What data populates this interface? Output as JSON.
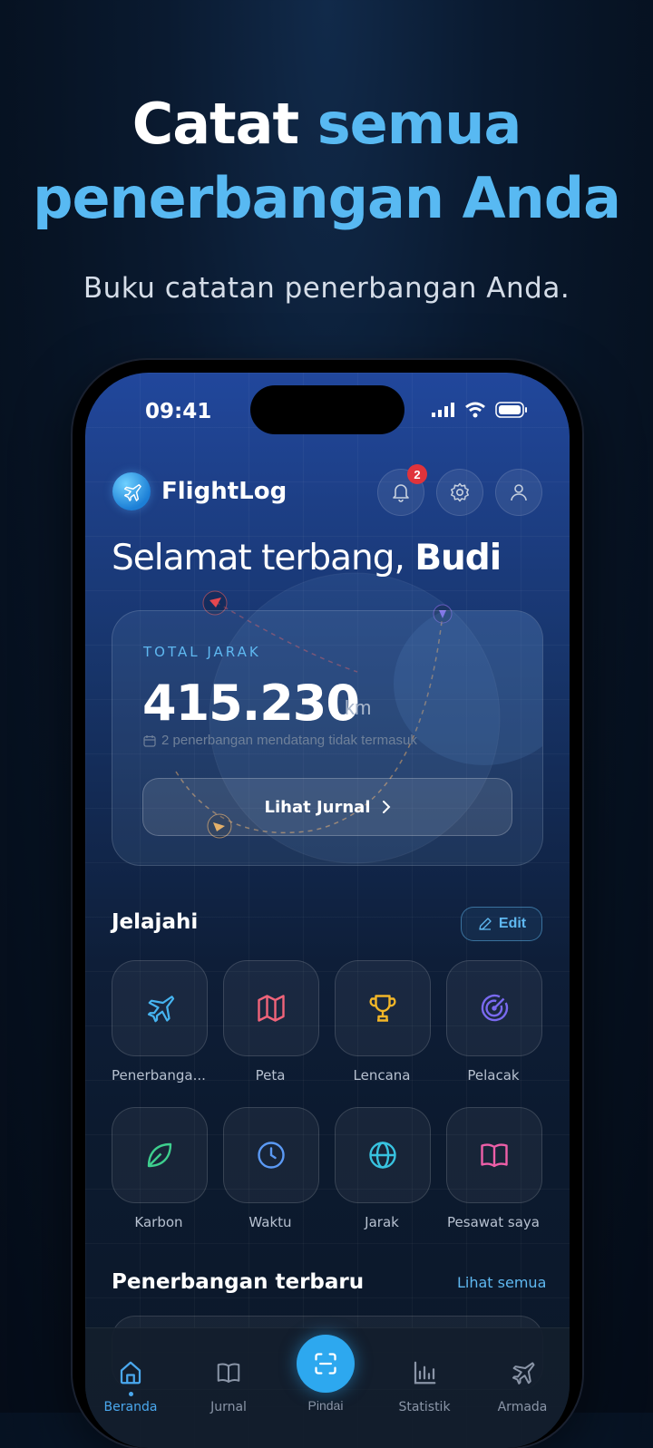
{
  "promo": {
    "headline_part1": "Catat ",
    "headline_part2": "semua",
    "headline_line2": "penerbangan Anda",
    "subtitle": "Buku catatan penerbangan Anda."
  },
  "status_bar": {
    "time": "09:41"
  },
  "header": {
    "app_name": "FlightLog",
    "notification_count": "2"
  },
  "greeting": {
    "prefix": "Selamat terbang, ",
    "name": "Budi"
  },
  "distance_card": {
    "label": "TOTAL JARAK",
    "value": "415.230",
    "unit": "km",
    "note": "2 penerbangan mendatang tidak termasuk",
    "button": "Lihat Jurnal"
  },
  "explore": {
    "title": "Jelajahi",
    "edit": "Edit",
    "tiles": [
      {
        "label": "Penerbanga...",
        "icon": "plane-icon",
        "color": "#46b4f0"
      },
      {
        "label": "Peta",
        "icon": "map-icon",
        "color": "#f0647a"
      },
      {
        "label": "Lencana",
        "icon": "trophy-icon",
        "color": "#f2b628"
      },
      {
        "label": "Pelacak",
        "icon": "radar-icon",
        "color": "#7a6af0"
      },
      {
        "label": "Karbon",
        "icon": "leaf-icon",
        "color": "#3ecf8e"
      },
      {
        "label": "Waktu",
        "icon": "clock-icon",
        "color": "#5b9af5"
      },
      {
        "label": "Jarak",
        "icon": "globe-icon",
        "color": "#38c3e0"
      },
      {
        "label": "Pesawat saya",
        "icon": "book-icon",
        "color": "#ee5fa8"
      }
    ]
  },
  "recent": {
    "title": "Penerbangan terbaru",
    "see_all": "Lihat semua"
  },
  "tabbar": {
    "tabs": [
      {
        "label": "Beranda",
        "icon": "home-icon",
        "active": true
      },
      {
        "label": "Jurnal",
        "icon": "book-icon"
      },
      {
        "label": "Pindai",
        "icon": "scan-icon"
      },
      {
        "label": "Statistik",
        "icon": "bar-chart-icon"
      },
      {
        "label": "Armada",
        "icon": "plane-icon"
      }
    ]
  }
}
